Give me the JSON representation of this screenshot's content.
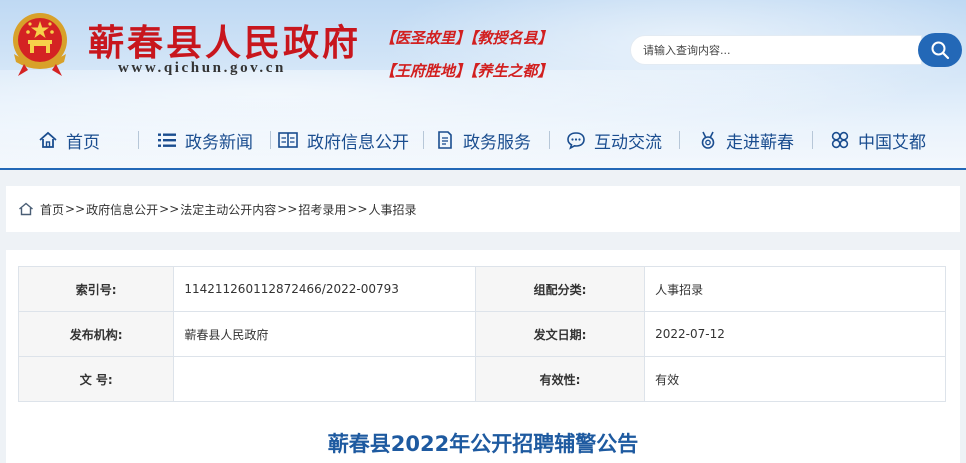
{
  "header": {
    "site_title": "蕲春县人民政府",
    "site_url": "www.qichun.gov.cn",
    "slogans": [
      "【医圣故里】【教授名县】",
      "【王府胜地】【养生之都】"
    ],
    "search_placeholder": "请输入查询内容..."
  },
  "nav": {
    "items": [
      {
        "label": "首页",
        "icon": "home-icon"
      },
      {
        "label": "政务新闻",
        "icon": "list-icon"
      },
      {
        "label": "政府信息公开",
        "icon": "book-icon"
      },
      {
        "label": "政务服务",
        "icon": "document-icon"
      },
      {
        "label": "互动交流",
        "icon": "chat-icon"
      },
      {
        "label": "走进蕲春",
        "icon": "medal-icon"
      },
      {
        "label": "中国艾都",
        "icon": "clover-icon"
      }
    ]
  },
  "breadcrumb": {
    "items": [
      "首页",
      "政府信息公开",
      "法定主动公开内容",
      "招考录用",
      "人事招录"
    ],
    "separator": ">>"
  },
  "meta_table": {
    "rows": [
      {
        "label1": "索引号:",
        "value1": "114211260112872466/2022-00793",
        "label2": "组配分类:",
        "value2": "人事招录"
      },
      {
        "label1": "发布机构:",
        "value1": "蕲春县人民政府",
        "label2": "发文日期:",
        "value2": "2022-07-12"
      },
      {
        "label1": "文 号:",
        "value1": "",
        "label2": "有效性:",
        "value2": "有效"
      }
    ]
  },
  "article": {
    "title": "蕲春县2022年公开招聘辅警公告"
  },
  "colors": {
    "brand_red": "#c8161d",
    "nav_blue": "#1a4d8f",
    "search_blue": "#2368b7",
    "title_blue": "#1e5aa0"
  }
}
